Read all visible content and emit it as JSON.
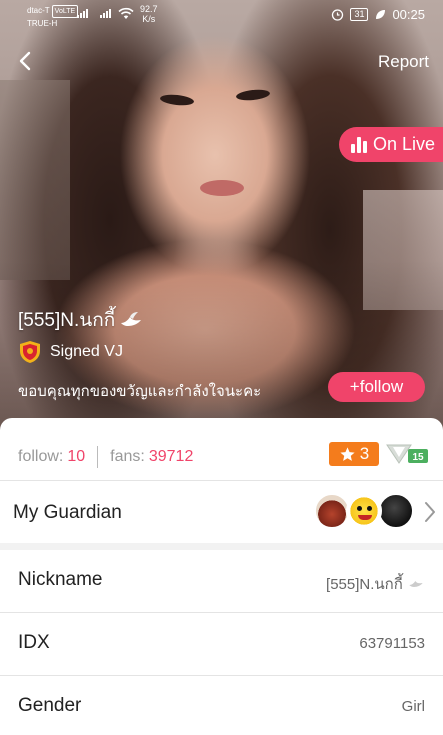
{
  "status_bar": {
    "carrier_top": "dtac-T",
    "volte": "VoLTE",
    "carrier_bottom": "TRUE-H",
    "speed_value": "92.7",
    "speed_unit": "K/s",
    "battery": "31",
    "time": "00:25"
  },
  "nav": {
    "report_label": "Report"
  },
  "live": {
    "label": "On Live"
  },
  "profile": {
    "name": "[555]N.นกกี้",
    "vj_label": "Signed VJ",
    "bio": "ขอบคุณทุกของขวัญและกำลังใจนะคะ",
    "follow_button": "+follow"
  },
  "stats": {
    "follow_label": "follow:",
    "follow_count": "10",
    "fans_label": "fans:",
    "fans_count": "39712",
    "star_level": "3",
    "v_level": "15"
  },
  "guardian": {
    "label": "My Guardian"
  },
  "details": [
    {
      "key": "Nickname",
      "value": "[555]N.นกกี้"
    },
    {
      "key": "IDX",
      "value": "63791153"
    },
    {
      "key": "Gender",
      "value": "Girl"
    }
  ],
  "colors": {
    "accent": "#f0446a",
    "star_badge": "#f47c1c"
  }
}
